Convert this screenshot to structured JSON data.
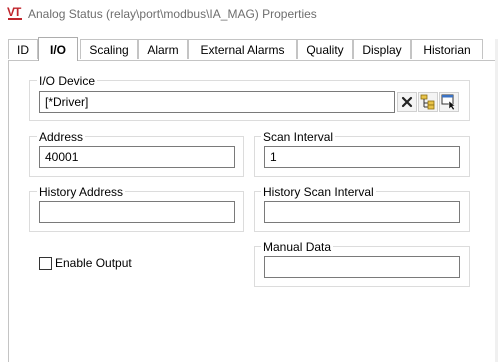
{
  "window": {
    "app_logo": "VT",
    "title": "Analog Status (relay\\port\\modbus\\IA_MAG) Properties"
  },
  "tabs": [
    {
      "label": "ID",
      "active": false
    },
    {
      "label": "I/O",
      "active": true
    },
    {
      "label": "Scaling",
      "active": false
    },
    {
      "label": "Alarm",
      "active": false
    },
    {
      "label": "External Alarms",
      "active": false
    },
    {
      "label": "Quality",
      "active": false
    },
    {
      "label": "Display",
      "active": false
    },
    {
      "label": "Historian",
      "active": false
    }
  ],
  "io_device": {
    "label": "I/O Device",
    "value": "[*Driver]",
    "buttons": [
      "clear-icon",
      "tree-browse-icon",
      "select-device-icon"
    ]
  },
  "address": {
    "label": "Address",
    "value": "40001"
  },
  "scan_interval": {
    "label": "Scan Interval",
    "value": "1"
  },
  "history_address": {
    "label": "History Address",
    "value": ""
  },
  "history_scan_interval": {
    "label": "History Scan Interval",
    "value": ""
  },
  "enable_output": {
    "label": "Enable Output",
    "checked": false
  },
  "manual_data": {
    "label": "Manual Data",
    "value": ""
  },
  "colors": {
    "logo_red": "#c0262d",
    "border": "#dcdcdc",
    "title_gray": "#6e6e6e"
  }
}
